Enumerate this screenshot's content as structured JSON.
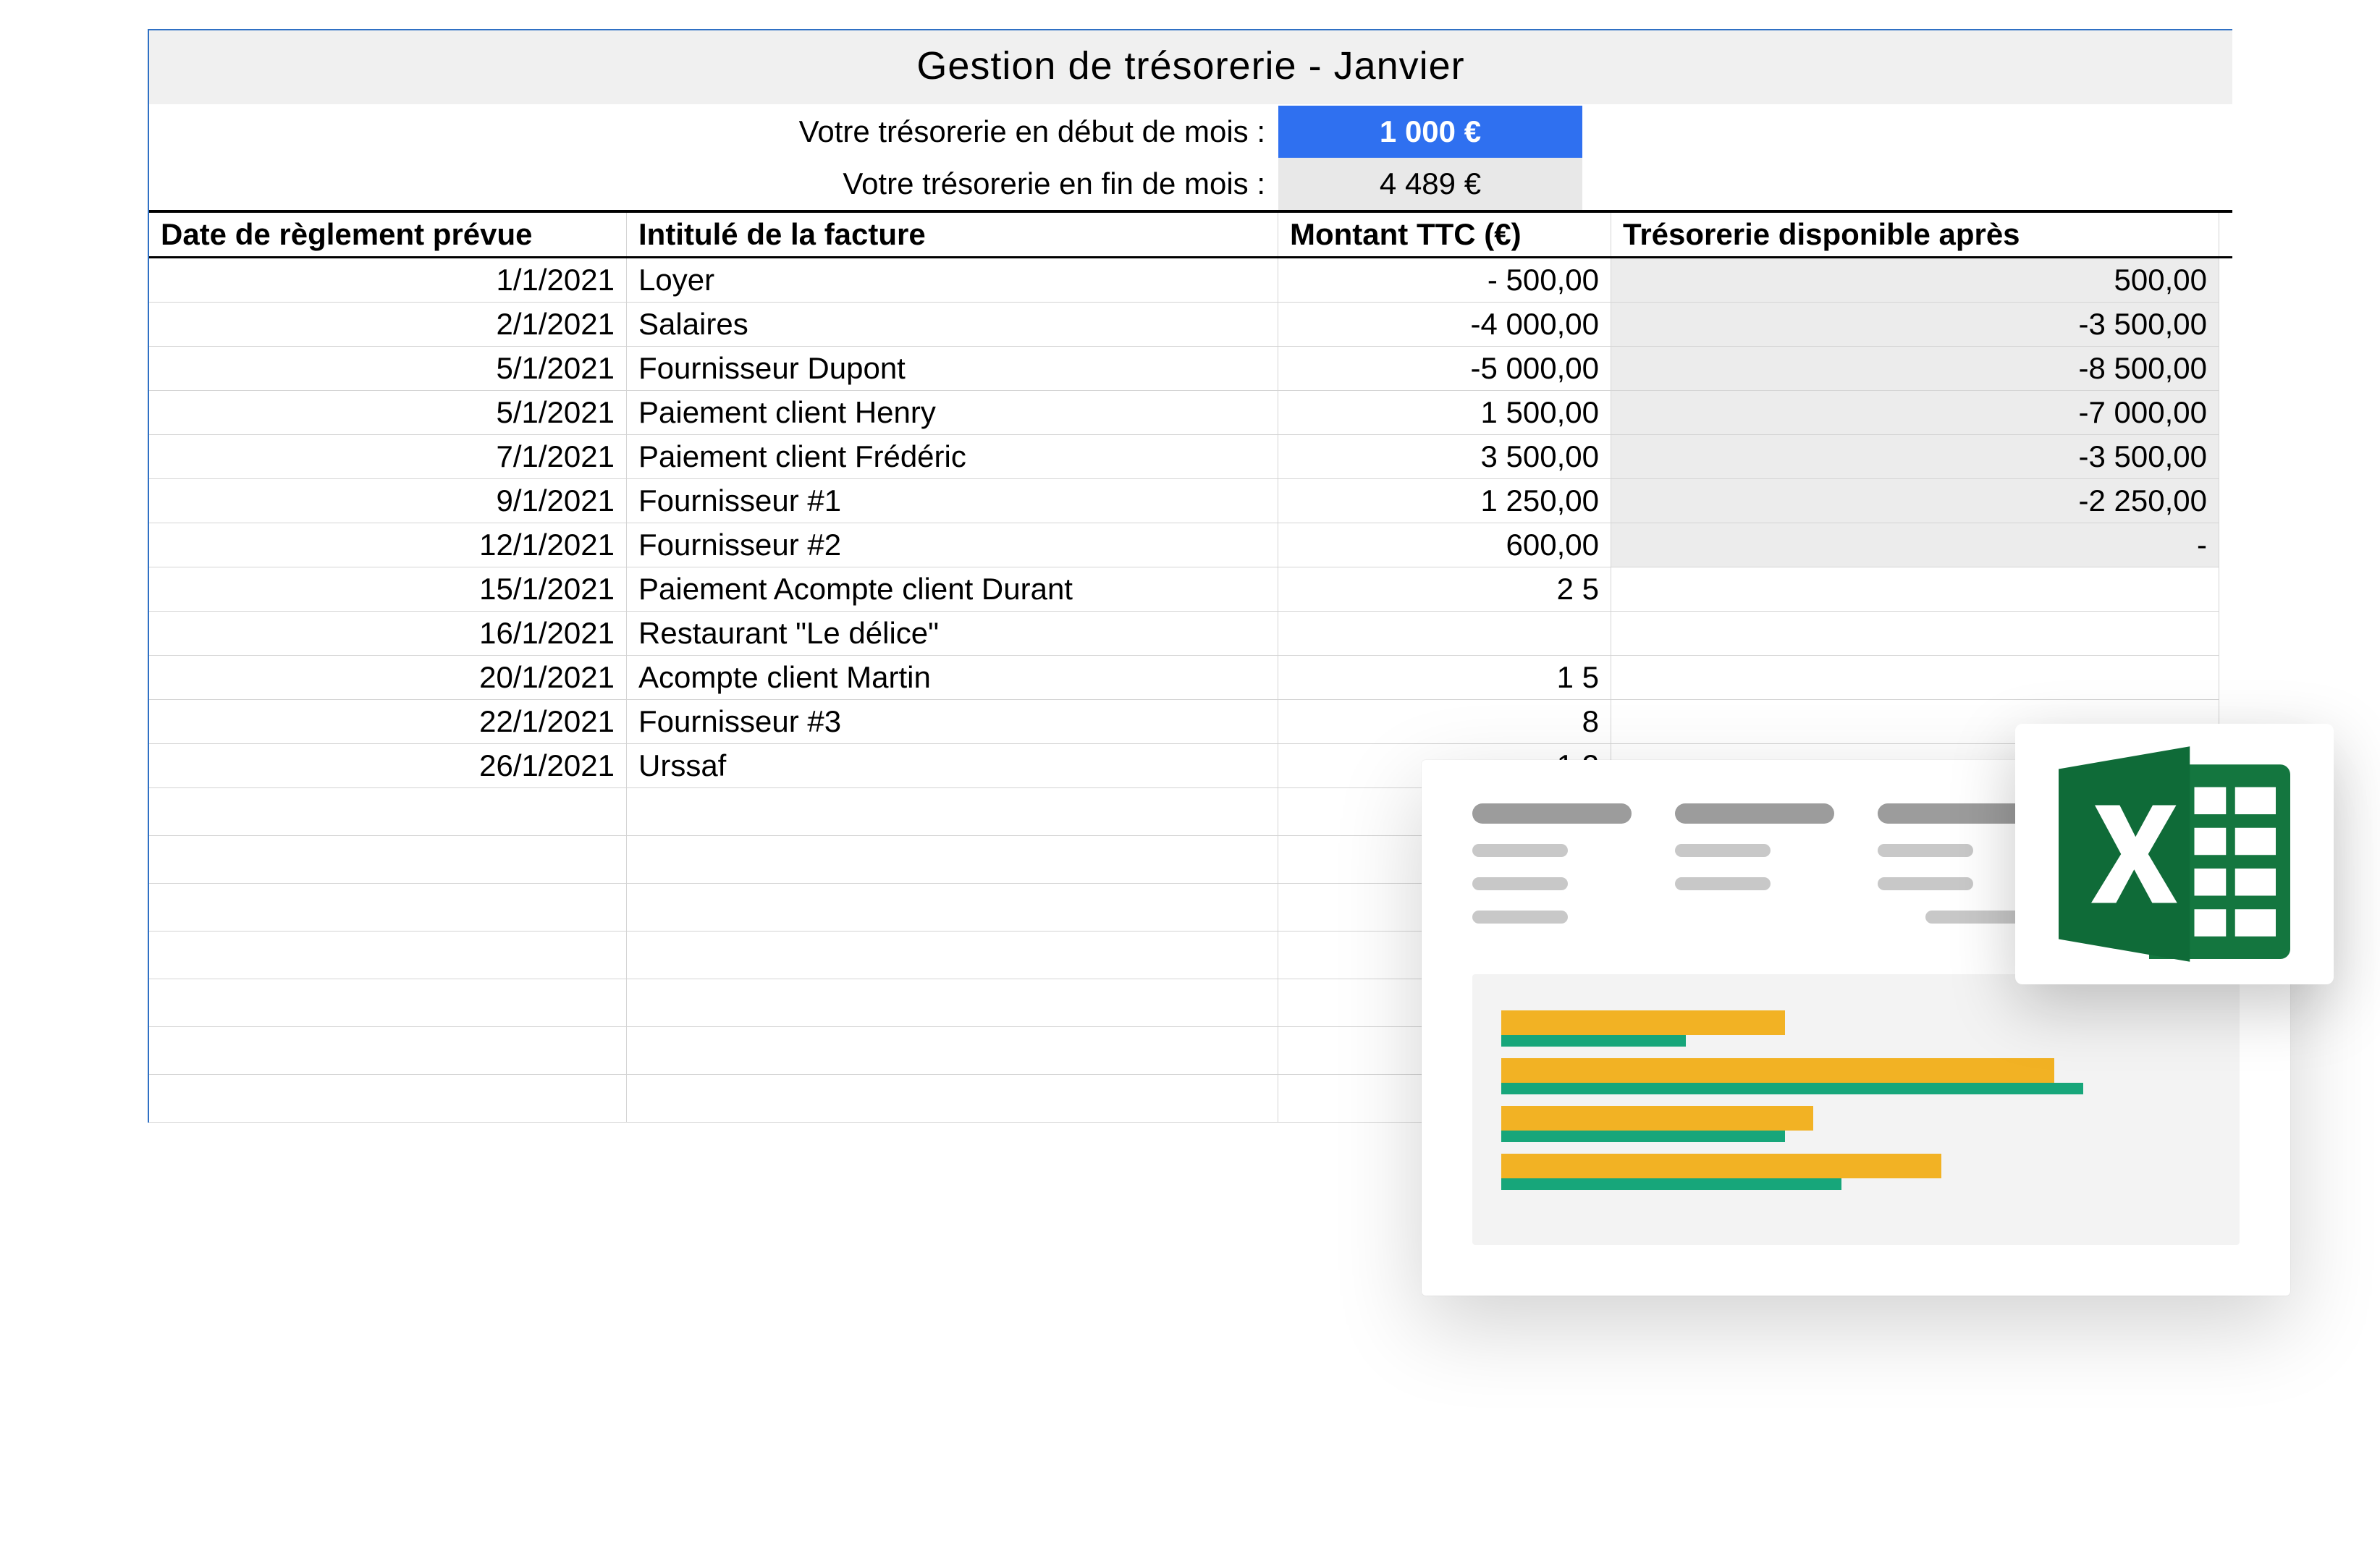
{
  "title": "Gestion de trésorerie - Janvier",
  "summary": {
    "start_label": "Votre trésorerie en début de mois :",
    "start_value": "1 000 €",
    "end_label": "Votre trésorerie en fin de mois :",
    "end_value": "4 489 €"
  },
  "headers": {
    "date": "Date de règlement prévue",
    "label": "Intitulé de la facture",
    "amount": "Montant TTC (€)",
    "balance": "Trésorerie disponible après"
  },
  "rows": [
    {
      "date": "1/1/2021",
      "label": "Loyer",
      "amount": "- 500,00",
      "balance": "500,00",
      "grey": true
    },
    {
      "date": "2/1/2021",
      "label": "Salaires",
      "amount": "-4 000,00",
      "balance": "-3 500,00",
      "grey": true
    },
    {
      "date": "5/1/2021",
      "label": "Fournisseur Dupont",
      "amount": "-5 000,00",
      "balance": "-8 500,00",
      "grey": true
    },
    {
      "date": "5/1/2021",
      "label": "Paiement client Henry",
      "amount": "1 500,00",
      "balance": "-7 000,00",
      "grey": true
    },
    {
      "date": "7/1/2021",
      "label": "Paiement client Frédéric",
      "amount": "3 500,00",
      "balance": "-3 500,00",
      "grey": true
    },
    {
      "date": "9/1/2021",
      "label": "Fournisseur #1",
      "amount": "1 250,00",
      "balance": "-2 250,00",
      "grey": true
    },
    {
      "date": "12/1/2021",
      "label": "Fournisseur #2",
      "amount": "600,00",
      "balance": "-",
      "grey": true
    },
    {
      "date": "15/1/2021",
      "label": "Paiement Acompte client Durant",
      "amount": "2 5",
      "balance": "",
      "grey": false
    },
    {
      "date": "16/1/2021",
      "label": "Restaurant \"Le délice\"",
      "amount": "",
      "balance": "",
      "grey": false
    },
    {
      "date": "20/1/2021",
      "label": "Acompte client Martin",
      "amount": "1 5",
      "balance": "",
      "grey": false
    },
    {
      "date": "22/1/2021",
      "label": "Fournisseur #3",
      "amount": "8",
      "balance": "",
      "grey": false
    },
    {
      "date": "26/1/2021",
      "label": "Urssaf",
      "amount": "1 2",
      "balance": "",
      "grey": false
    }
  ],
  "empty_row_count": 7,
  "chart_data": {
    "type": "bar",
    "note": "Stylized horizontal gantt-style bars (decorative overlay, no axis labels visible)",
    "series": [
      {
        "name": "yellow",
        "values": [
          40,
          78,
          44,
          62
        ]
      },
      {
        "name": "green",
        "values": [
          26,
          82,
          40,
          48
        ]
      }
    ]
  }
}
